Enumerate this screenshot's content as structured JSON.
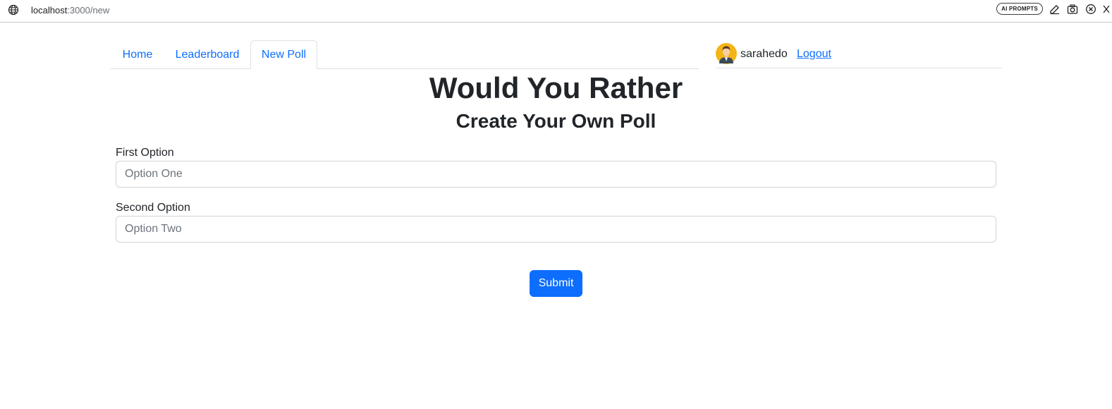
{
  "browser": {
    "url_host": "localhost",
    "url_path": ":3000/new",
    "ai_prompts_label": "AI PROMPTS",
    "icons": [
      "globe-icon",
      "edit-icon",
      "camera-icon",
      "close-circle-icon"
    ]
  },
  "nav": {
    "tabs": [
      {
        "label": "Home",
        "active": false
      },
      {
        "label": "Leaderboard",
        "active": false
      },
      {
        "label": "New Poll",
        "active": true
      }
    ],
    "user": {
      "avatar_icon": "avatar-icon",
      "name": "sarahedo",
      "logout_label": "Logout"
    }
  },
  "page": {
    "title": "Would You Rather",
    "subtitle": "Create Your Own Poll"
  },
  "form": {
    "first_label": "First Option",
    "first_value": "",
    "first_placeholder": "Option One",
    "second_label": "Second Option",
    "second_value": "",
    "second_placeholder": "Option Two",
    "submit_label": "Submit"
  },
  "colors": {
    "primary": "#0d6efd",
    "text": "#212529",
    "border": "#dee2e6",
    "input_border": "#ced4da",
    "avatar_bg": "#f5b415"
  }
}
